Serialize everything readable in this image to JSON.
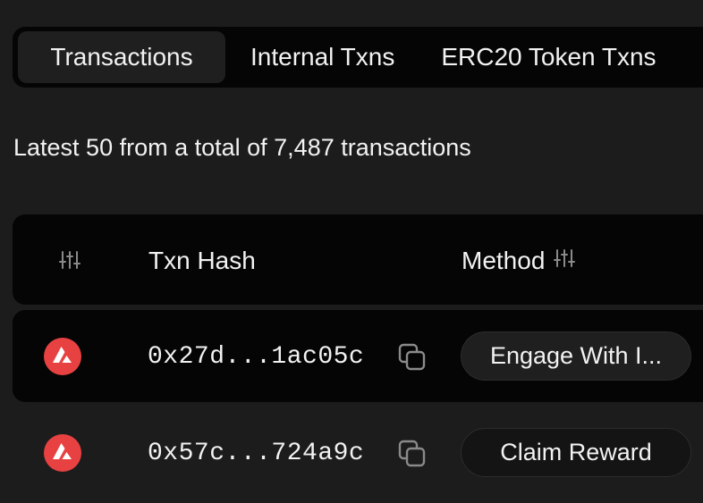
{
  "tabs": [
    {
      "label": "Transactions",
      "active": true
    },
    {
      "label": "Internal Txns",
      "active": false
    },
    {
      "label": "ERC20 Token Txns",
      "active": false
    }
  ],
  "summary": "Latest 50 from a total of 7,487 transactions",
  "table": {
    "headers": {
      "filter_icon": "sliders-icon",
      "txn_hash": "Txn Hash",
      "method": "Method",
      "method_filter_icon": "sliders-icon"
    },
    "rows": [
      {
        "chain_icon": "avalanche-icon",
        "hash": "0x27d...1ac05c",
        "copy_icon": "copy-icon",
        "method": "Engage With I..."
      },
      {
        "chain_icon": "avalanche-icon",
        "hash": "0x57c...724a9c",
        "copy_icon": "copy-icon",
        "method": "Claim Reward"
      }
    ]
  },
  "colors": {
    "background": "#1c1c1c",
    "panel": "#050505",
    "text": "#f2f2f2",
    "avalanche_red": "#e84142",
    "icon_gray": "#8a8a8a"
  }
}
